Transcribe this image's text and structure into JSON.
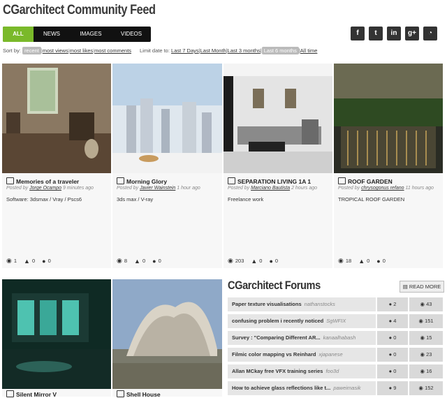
{
  "page": {
    "title": "CGarchitect Community Feed"
  },
  "tabs": [
    {
      "label": "ALL",
      "active": true
    },
    {
      "label": "NEWS",
      "active": false
    },
    {
      "label": "IMAGES",
      "active": false
    },
    {
      "label": "VIDEOS",
      "active": false
    }
  ],
  "social": [
    {
      "icon": "facebook-icon",
      "glyph": "f"
    },
    {
      "icon": "twitter-icon",
      "glyph": "t"
    },
    {
      "icon": "linkedin-icon",
      "glyph": "in"
    },
    {
      "icon": "googleplus-icon",
      "glyph": "g+"
    },
    {
      "icon": "rss-icon",
      "glyph": "◔"
    }
  ],
  "sort": {
    "label": "Sort by:",
    "options": [
      "recent",
      "most views",
      "most likes",
      "most comments"
    ],
    "selected": "recent"
  },
  "limit": {
    "label": "Limit date to:",
    "options": [
      "Last 7 Days",
      "Last Month",
      "Last 3 months",
      "Last 6 months",
      "All time"
    ],
    "selected": "Last 6 months"
  },
  "cards": [
    {
      "title": "Memories of a traveler",
      "posted_by": "Posted by",
      "author": "Jorge Ocampo",
      "time": "9 minutes ago",
      "desc": "Software: 3dsmax / Vray / Pscs6",
      "views": "1",
      "likes": "0",
      "comments": "0"
    },
    {
      "title": "Morning Glory",
      "posted_by": "Posted by",
      "author": "Javier Wainstein",
      "time": "1 hour ago",
      "desc": "3ds max / V-ray",
      "views": "8",
      "likes": "0",
      "comments": "0"
    },
    {
      "title": "SEPARATION LIVING 1A 1",
      "posted_by": "Posted by",
      "author": "Marciano Bautista",
      "time": "2 hours ago",
      "desc": "Freelance work",
      "views": "203",
      "likes": "0",
      "comments": "0"
    },
    {
      "title": "ROOF GARDEN",
      "posted_by": "Posted by",
      "author": "chrysogonus refano",
      "time": "11 hours ago",
      "desc": "TROPICAL ROOF GARDEN",
      "views": "18",
      "likes": "0",
      "comments": "0"
    },
    {
      "title": "Silent Mirror V"
    },
    {
      "title": "Shell House"
    }
  ],
  "forum": {
    "title": "CGarchitect Forums",
    "read_more": "READ MORE",
    "rows": [
      {
        "topic": "Paper texture visualisations",
        "author": "nathanstocks",
        "comments": "2",
        "views": "43"
      },
      {
        "topic": "confusing problem i recently noticed",
        "author": "SgWFIX",
        "comments": "4",
        "views": "151"
      },
      {
        "topic": "Survey : \"Comparing Different AR...",
        "author": "kanaalhabash",
        "comments": "0",
        "views": "15"
      },
      {
        "topic": "Filmic color mapping vs Reinhard",
        "author": "xjapanese",
        "comments": "0",
        "views": "23"
      },
      {
        "topic": "Allan MCkay free VFX training series",
        "author": "foo3d",
        "comments": "0",
        "views": "16"
      },
      {
        "topic": "How to achieve glass reflections like t...",
        "author": "paweimasik",
        "comments": "9",
        "views": "152"
      }
    ]
  }
}
